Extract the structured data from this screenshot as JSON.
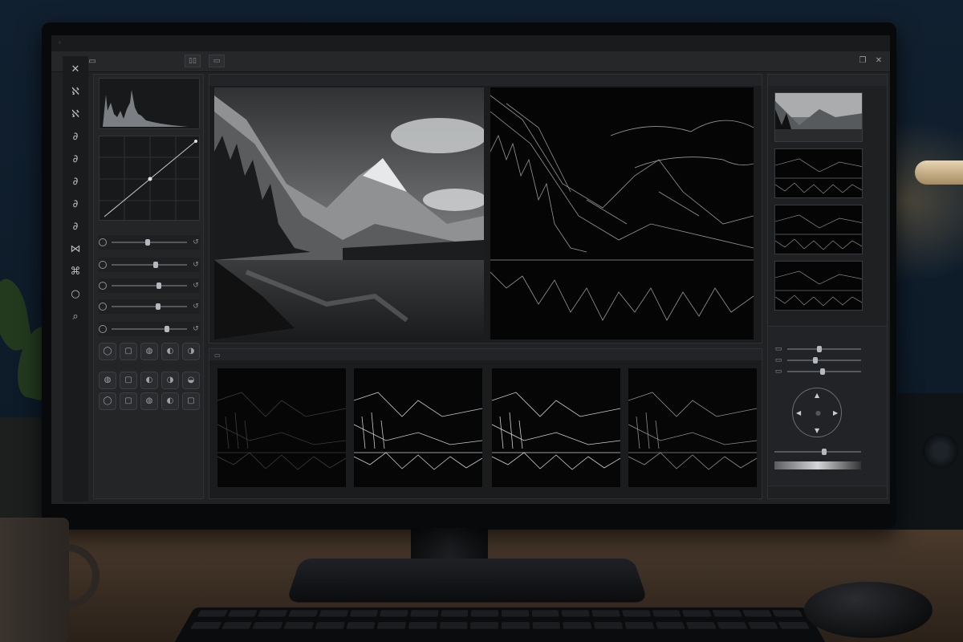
{
  "app": {
    "title": ""
  },
  "toolbar": {
    "tools": [
      {
        "name": "close-tool-icon",
        "glyph": "✕"
      },
      {
        "name": "tool-1-icon",
        "glyph": "ℵ"
      },
      {
        "name": "tool-2-icon",
        "glyph": "ℵ"
      },
      {
        "name": "tool-3-icon",
        "glyph": "∂"
      },
      {
        "name": "tool-4-icon",
        "glyph": "∂"
      },
      {
        "name": "tool-5-icon",
        "glyph": "∂"
      },
      {
        "name": "tool-6-icon",
        "glyph": "∂"
      },
      {
        "name": "tool-7-icon",
        "glyph": "∂"
      },
      {
        "name": "tool-8-icon",
        "glyph": "⋈"
      },
      {
        "name": "tool-9-icon",
        "glyph": "⌘"
      },
      {
        "name": "tool-10-icon",
        "glyph": "○"
      },
      {
        "name": "zoom-tool-icon",
        "glyph": "⌕"
      }
    ]
  },
  "left_panel": {
    "sliders": [
      {
        "name": "slider-1",
        "value": 0.45
      },
      {
        "name": "slider-2",
        "value": 0.55
      },
      {
        "name": "slider-3",
        "value": 0.6
      },
      {
        "name": "slider-4",
        "value": 0.58
      },
      {
        "name": "slider-5",
        "value": 0.7
      }
    ],
    "button_rows": 3
  },
  "viewer": {
    "original_label": "",
    "edge_label": ""
  },
  "strip": {
    "thumbnails": 4
  },
  "right_col": {
    "thumbnails": 4
  },
  "adjust_panel": {
    "sliders": [
      0.4,
      0.35,
      0.45
    ],
    "bottom_slider": 0.55
  }
}
